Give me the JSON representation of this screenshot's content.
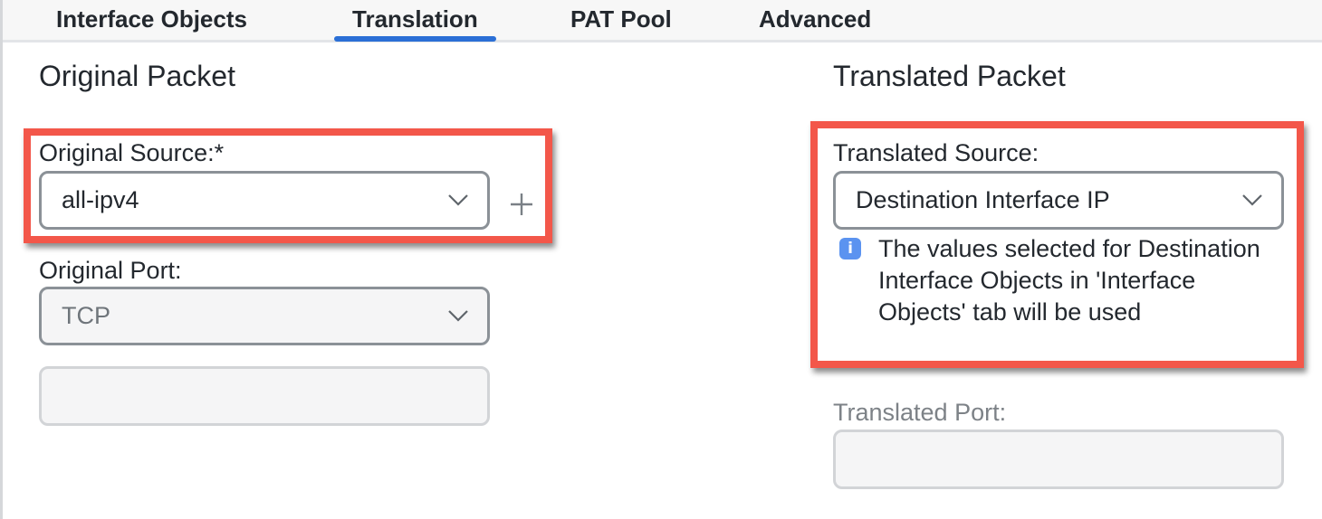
{
  "tabs": [
    {
      "label": "Interface Objects",
      "active": false
    },
    {
      "label": "Translation",
      "active": true
    },
    {
      "label": "PAT Pool",
      "active": false
    },
    {
      "label": "Advanced",
      "active": false
    }
  ],
  "accent_color": "#2b6fd6",
  "highlight_color": "#f3574a",
  "original_packet": {
    "title": "Original Packet",
    "source": {
      "label": "Original Source:*",
      "value": "all-ipv4",
      "add_icon": "plus-icon"
    },
    "port": {
      "label": "Original Port:",
      "value": "TCP",
      "port_value": ""
    }
  },
  "translated_packet": {
    "title": "Translated Packet",
    "source": {
      "label": "Translated Source:",
      "value": "Destination Interface IP",
      "info_icon": "i",
      "info_text": "The values selected for Destination Interface Objects in 'Interface Objects' tab will be used"
    },
    "port": {
      "label": "Translated Port:",
      "value": ""
    }
  }
}
